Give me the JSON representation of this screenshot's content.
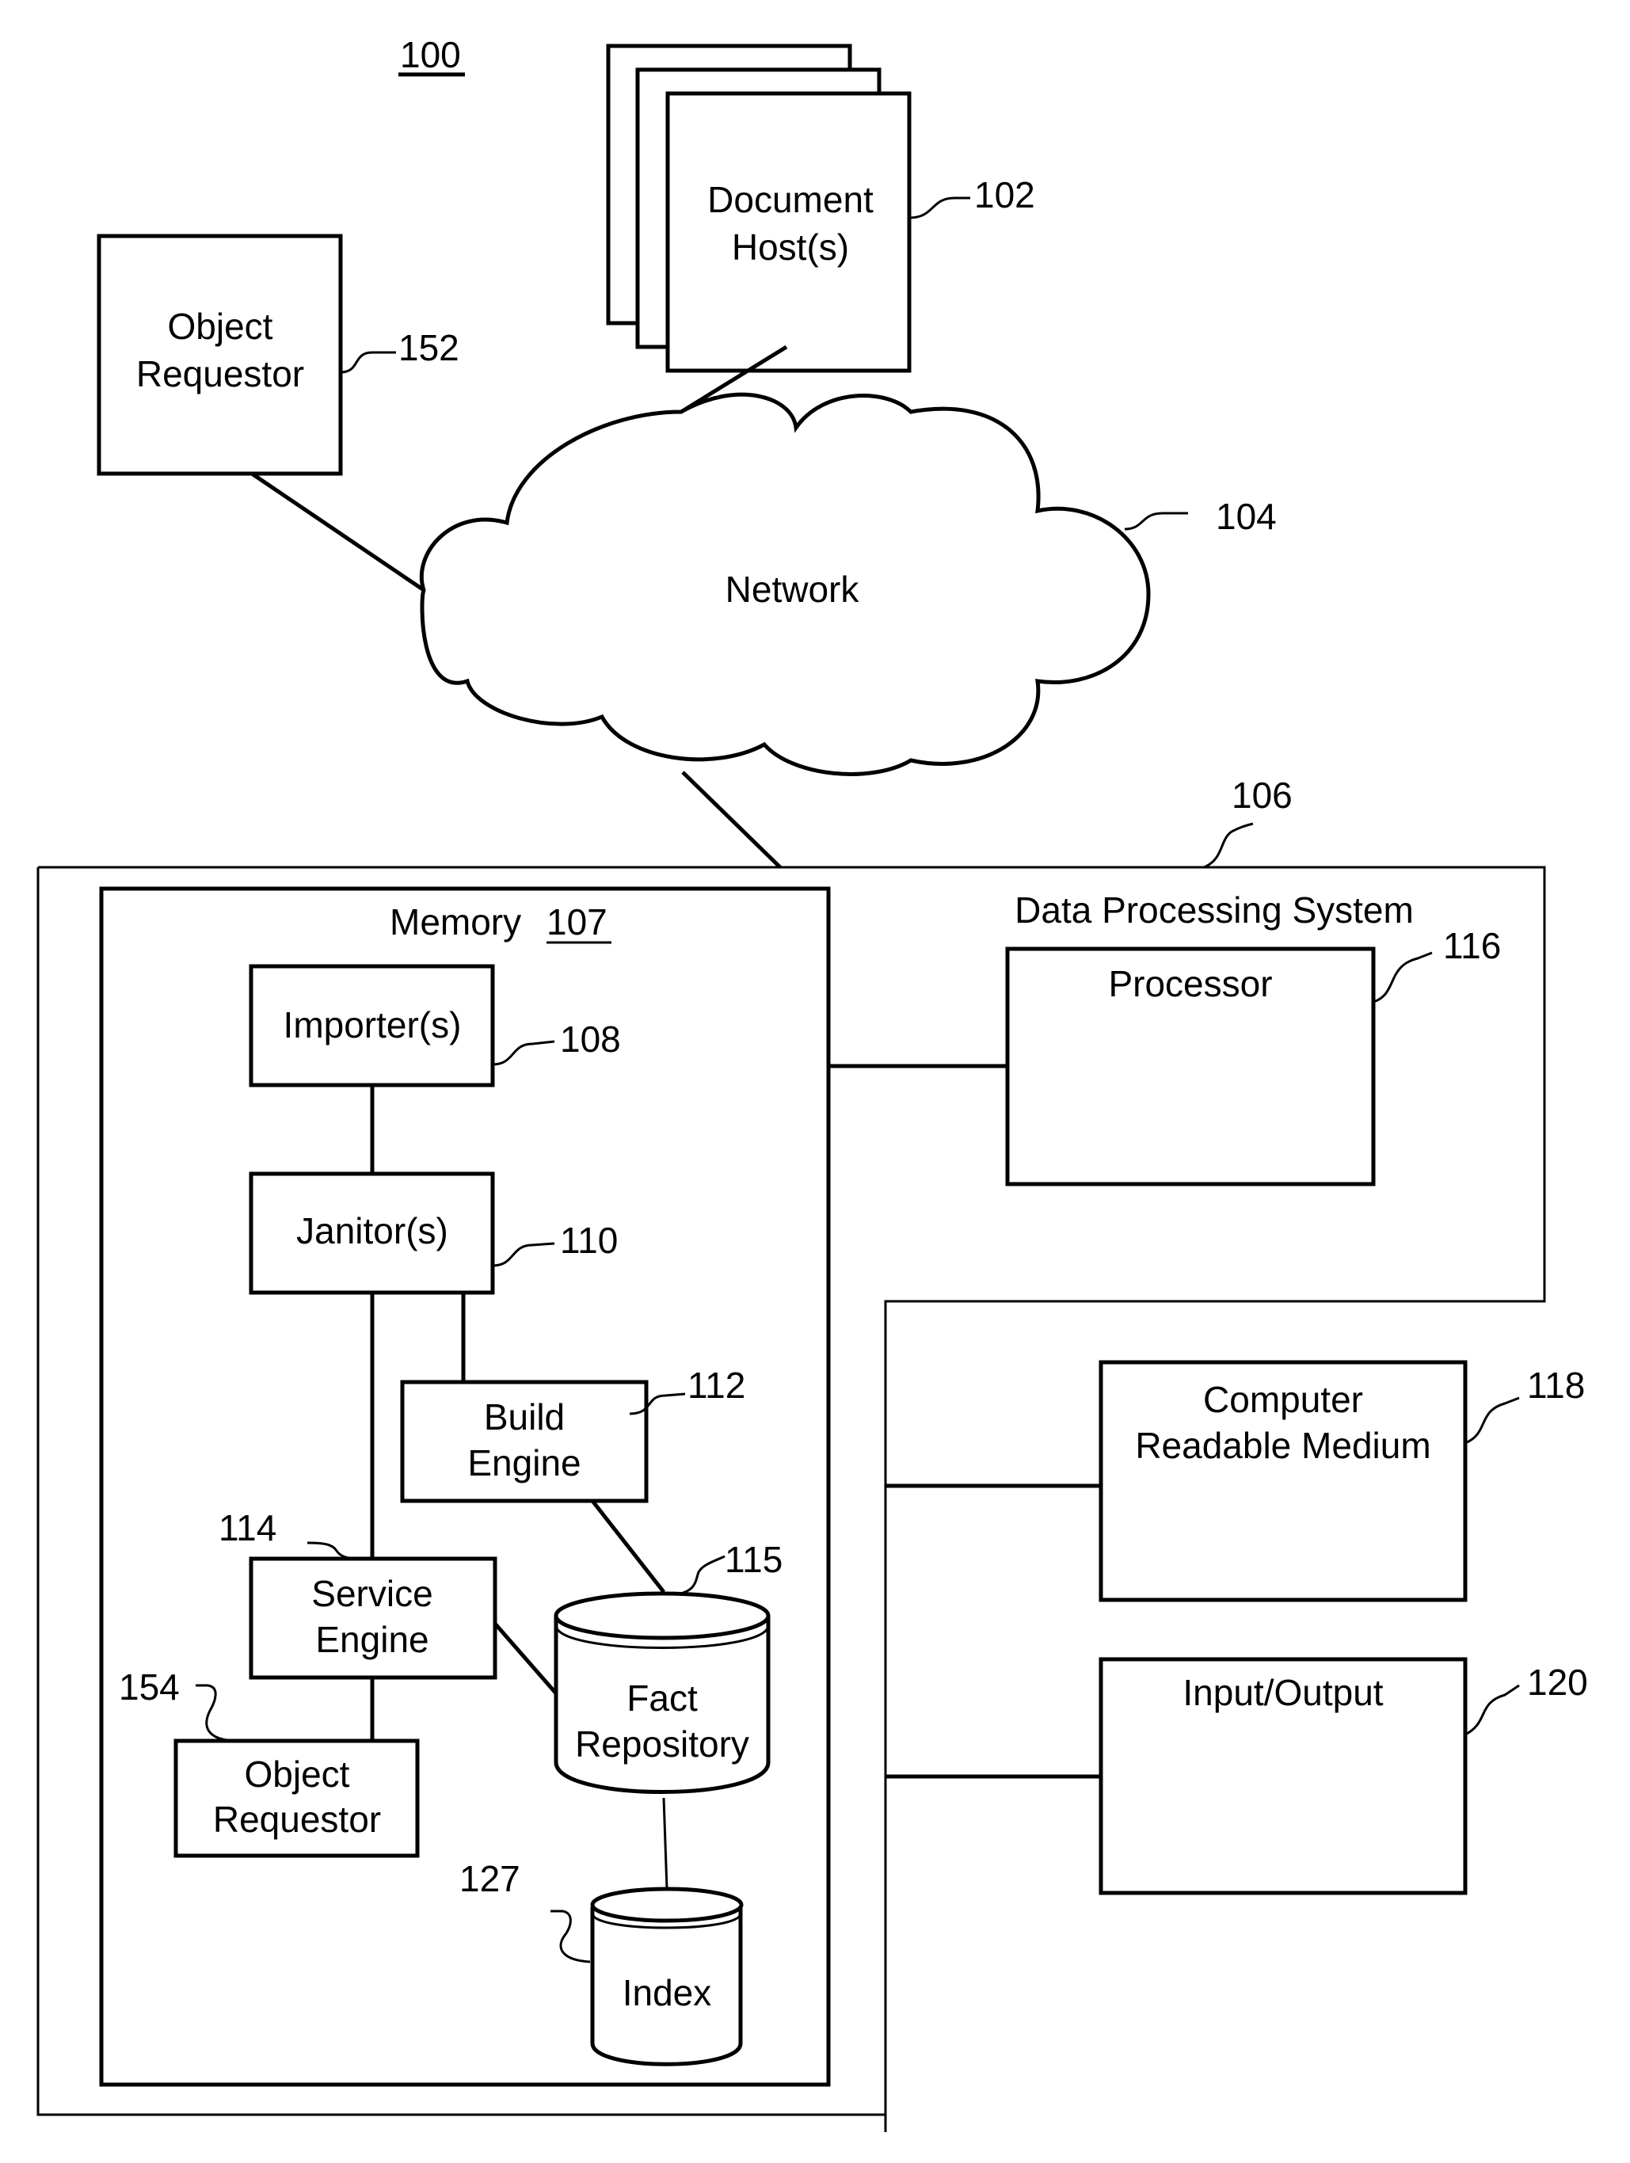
{
  "figure": {
    "ref": "100",
    "components": {
      "document_hosts": {
        "label_lines": [
          "Document",
          "Host(s)"
        ],
        "ref": "102"
      },
      "object_requestor_external": {
        "label_lines": [
          "Object",
          "Requestor"
        ],
        "ref": "152"
      },
      "network": {
        "label": "Network",
        "ref": "104"
      },
      "data_processing_system": {
        "label": "Data Processing System",
        "ref": "106"
      },
      "memory": {
        "label": "Memory",
        "ref": "107"
      },
      "importers": {
        "label": "Importer(s)",
        "ref": "108"
      },
      "janitors": {
        "label": "Janitor(s)",
        "ref": "110"
      },
      "build_engine": {
        "label_lines": [
          "Build",
          "Engine"
        ],
        "ref": "112"
      },
      "service_engine": {
        "label_lines": [
          "Service",
          "Engine"
        ],
        "ref": "114"
      },
      "fact_repository": {
        "label_lines": [
          "Fact",
          "Repository"
        ],
        "ref": "115"
      },
      "object_requestor_internal": {
        "label_lines": [
          "Object",
          "Requestor"
        ],
        "ref": "154"
      },
      "index": {
        "label": "Index",
        "ref": "127"
      },
      "processor": {
        "label": "Processor",
        "ref": "116"
      },
      "computer_readable_medium": {
        "label_lines": [
          "Computer",
          "Readable Medium"
        ],
        "ref": "118"
      },
      "input_output": {
        "label": "Input/Output",
        "ref": "120"
      }
    }
  }
}
